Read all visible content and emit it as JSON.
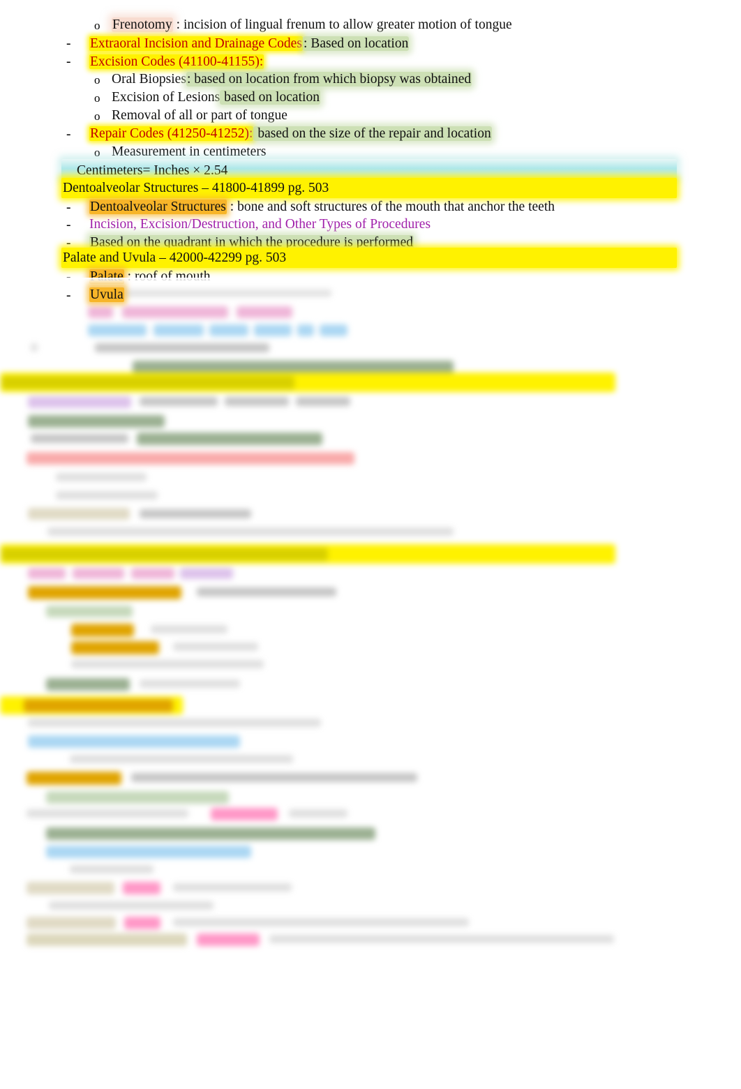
{
  "document": {
    "type": "study-notes",
    "page_background": "#ffffff",
    "colors": {
      "highlight_yellow": "#fff200",
      "highlight_orange": "#f7b529",
      "highlight_green": "#c4dba8",
      "highlight_cyan": "#9be2e2",
      "text_red": "#c00000",
      "text_purple": "#a01faa",
      "text_black": "#101010"
    }
  },
  "visible_lines": [
    {
      "id": "frenotomy",
      "bullet": "o",
      "indent": 2,
      "segments": [
        {
          "text": "Frenotomy",
          "highlight": "pink-glow",
          "color": "black"
        },
        {
          "text": " : incision of lingual frenum to allow greater motion of tongue",
          "highlight": "none",
          "color": "black"
        }
      ]
    },
    {
      "id": "extraoral-incision-drainage",
      "bullet": "-",
      "indent": 1,
      "segments": [
        {
          "text": "Extraoral Incision and Drainage Codes",
          "highlight": "yellow",
          "color": "red"
        },
        {
          "text": ": Based on location",
          "highlight": "green",
          "color": "black"
        }
      ]
    },
    {
      "id": "excision-codes",
      "bullet": "-",
      "indent": 1,
      "segments": [
        {
          "text": "Excision Codes (41100-41155):",
          "highlight": "yellow",
          "color": "red"
        }
      ]
    },
    {
      "id": "oral-biopsies",
      "bullet": "o",
      "indent": 2,
      "segments": [
        {
          "text": "Oral Biopsies",
          "highlight": "none",
          "color": "black"
        },
        {
          "text": ": based on location from which biopsy was obtained",
          "highlight": "green",
          "color": "black"
        }
      ]
    },
    {
      "id": "excision-of-lesions",
      "bullet": "o",
      "indent": 2,
      "segments": [
        {
          "text": "Excision of Lesions",
          "highlight": "none",
          "color": "black"
        },
        {
          "text": " based on location",
          "highlight": "green",
          "color": "black"
        }
      ]
    },
    {
      "id": "removal-tongue",
      "bullet": "o",
      "indent": 2,
      "segments": [
        {
          "text": "Removal of all or part of tongue",
          "highlight": "none",
          "color": "black"
        }
      ]
    },
    {
      "id": "repair-codes",
      "bullet": "-",
      "indent": 1,
      "segments": [
        {
          "text": "Repair Codes (41250-41252):",
          "highlight": "yellow",
          "color": "red"
        },
        {
          "text": " based on the size of the repair and location",
          "highlight": "green",
          "color": "black"
        }
      ]
    },
    {
      "id": "measurement-cm",
      "bullet": "o",
      "indent": 2,
      "segments": [
        {
          "text": "Measurement in centimeters",
          "highlight": "none",
          "color": "black"
        }
      ]
    },
    {
      "id": "centimeters-formula",
      "bullet": "",
      "indent": 0,
      "band": "cyan",
      "segments": [
        {
          "text": "Centimeters",
          "highlight": "none",
          "color": "black"
        },
        {
          "text": "= Inches × 2.54",
          "highlight": "none",
          "color": "black"
        }
      ]
    },
    {
      "id": "dentoalveolar-heading",
      "bullet": "",
      "indent": 0,
      "band": "yellow",
      "segments": [
        {
          "text": "Dentoalveolar Structures – 41800-41899 pg. 503",
          "highlight": "band-yellow",
          "color": "black"
        }
      ]
    },
    {
      "id": "dentoalveolar-def",
      "bullet": "-",
      "indent": 1,
      "segments": [
        {
          "text": "Dentoalveolar Structures",
          "highlight": "orange",
          "color": "black"
        },
        {
          "text": " : bone and soft structures of the mouth that anchor the teeth",
          "highlight": "none",
          "color": "black"
        }
      ]
    },
    {
      "id": "incision-excision-types",
      "bullet": "-",
      "indent": 1,
      "segments": [
        {
          "text": "Incision, Excision/Destruction, and Other Types of Procedures",
          "highlight": "none",
          "color": "purple"
        }
      ]
    },
    {
      "id": "based-on-quadrant",
      "bullet": "-",
      "indent": 1,
      "segments": [
        {
          "text": "Based on the quadrant in which the procedure is performed",
          "highlight": "green",
          "color": "black"
        }
      ]
    },
    {
      "id": "palate-uvula-heading",
      "bullet": "",
      "indent": 0,
      "band": "yellow",
      "segments": [
        {
          "text": "Palate and Uvula – 42000-42299 pg. 503",
          "highlight": "band-yellow",
          "color": "black"
        }
      ]
    },
    {
      "id": "palate-def",
      "bullet": "-",
      "indent": 1,
      "segments": [
        {
          "text": "Palate",
          "highlight": "orange",
          "color": "black"
        },
        {
          "text": " : roof of mouth",
          "highlight": "none",
          "color": "black"
        }
      ]
    },
    {
      "id": "uvula-def",
      "bullet": "-",
      "indent": 1,
      "segments": [
        {
          "text": "Uvula",
          "highlight": "orange",
          "color": "black"
        }
      ]
    }
  ],
  "obscured_region": {
    "note": "Lower portion of the page is blurred beyond legibility; only highlight bands and text-block shapes are discernible.",
    "starts_at_line": "uvula-def",
    "visible_highlight_colors": [
      "yellow",
      "orange",
      "green",
      "pink",
      "blue",
      "red",
      "purple",
      "tan"
    ]
  }
}
